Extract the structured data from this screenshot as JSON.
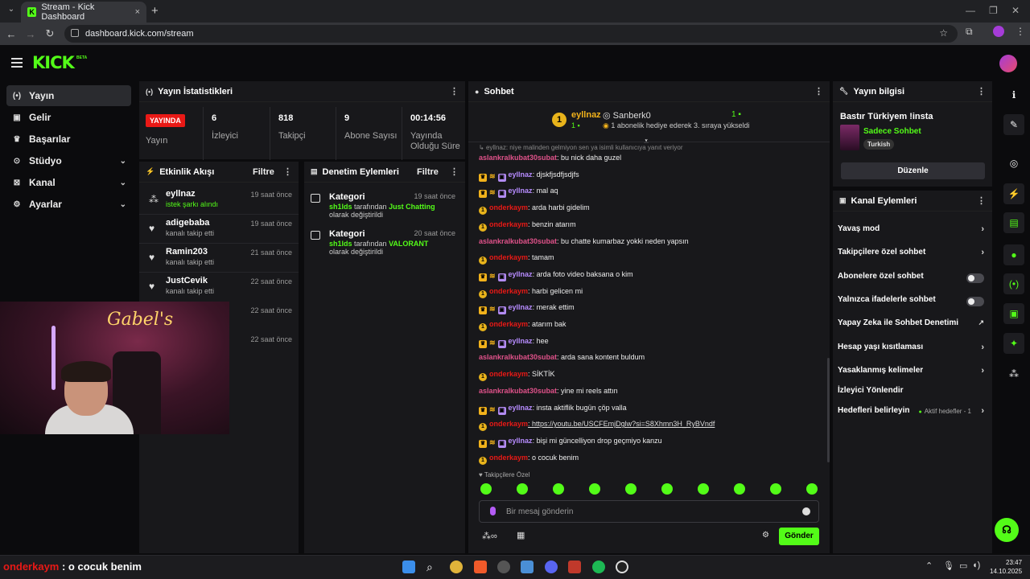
{
  "browser": {
    "tab_title": "Stream - Kick Dashboard",
    "url": "dashboard.kick.com/stream",
    "new_tab": "+",
    "close_tab": "×"
  },
  "app": {
    "logo": "KICK",
    "beta": "BETA"
  },
  "sidebar": {
    "items": [
      {
        "label": "Yayın",
        "icon": "broadcast-icon"
      },
      {
        "label": "Gelir",
        "icon": "revenue-icon"
      },
      {
        "label": "Başarılar",
        "icon": "trophy-icon"
      },
      {
        "label": "Stüdyo",
        "icon": "studio-icon"
      },
      {
        "label": "Kanal",
        "icon": "channel-icon"
      },
      {
        "label": "Ayarlar",
        "icon": "gear-icon"
      }
    ]
  },
  "stats": {
    "title": "Yayın İstatistikleri",
    "live_badge": "YAYINDA",
    "live_label": "Yayın",
    "items": [
      {
        "value": "6",
        "label": "İzleyici"
      },
      {
        "value": "818",
        "label": "Takipçi"
      },
      {
        "value": "9",
        "label": "Abone Sayısı"
      },
      {
        "value": "00:14:56",
        "label": "Yayında Olduğu Süre"
      }
    ]
  },
  "activity": {
    "title": "Etkinlik Akışı",
    "filter": "Filtre",
    "items": [
      {
        "name": "eyllnaz",
        "sub": "istek şarkı alındı",
        "time": "19 saat önce"
      },
      {
        "name": "adigebaba",
        "sub": "kanalı takip etti",
        "time": "19 saat önce"
      },
      {
        "name": "Ramin203",
        "sub": "kanalı takip etti",
        "time": "21 saat önce"
      },
      {
        "name": "JustCevik",
        "sub": "kanalı takip etti",
        "time": "22 saat önce"
      },
      {
        "name": "",
        "sub": "",
        "time": "22 saat önce"
      },
      {
        "name": "",
        "sub": "",
        "time": "22 saat önce"
      }
    ]
  },
  "moderation": {
    "title": "Denetim Eylemleri",
    "filter": "Filtre",
    "items": [
      {
        "title": "Kategori",
        "actor": "sh1lds",
        "mid": " tarafından ",
        "target": "Just Chatting",
        "end": " olarak değiştirildi",
        "time": "19 saat önce"
      },
      {
        "title": "Kategori",
        "actor": "sh1lds",
        "mid": " tarafından ",
        "target": "VALORANT",
        "end": " olarak değiştirildi",
        "time": "20 saat önce"
      }
    ]
  },
  "chat": {
    "title": "Sohbet",
    "pinned_rank": "1",
    "pinned_user": "eyllnaz",
    "pinned_count": "1",
    "gifter": "Sanberk0",
    "gifter_count": "1",
    "gift_text": "1 abonelik hediye ederek 3. sıraya yükseldi",
    "reply_hint": "eyllnaz: niye malinden gelmiyon sen ya isimli kullanıcıya yanıt veriyor",
    "messages": [
      {
        "user": "aslankralkubat30subat",
        "text": ": bu nick daha guzel",
        "style": "pink"
      },
      {
        "user": "eyllnaz",
        "text": ": djskfjsdfjsdjfs",
        "style": "purple"
      },
      {
        "user": "eyllnaz",
        "text": ": mal aq",
        "style": "purple"
      },
      {
        "user": "onderkaym",
        "text": ": arda harbi gidelim",
        "style": "red"
      },
      {
        "user": "onderkaym",
        "text": ": benzin atarım",
        "style": "red"
      },
      {
        "user": "aslankralkubat30subat",
        "text": ": bu chatte kumarbaz yokki neden yapsın",
        "style": "pink"
      },
      {
        "user": "onderkaym",
        "text": ": tamam",
        "style": "red"
      },
      {
        "user": "eyllnaz",
        "text": ": arda foto video baksana o kim",
        "style": "purple"
      },
      {
        "user": "onderkaym",
        "text": ": harbi gelicen mi",
        "style": "red"
      },
      {
        "user": "eyllnaz",
        "text": ": merak ettim",
        "style": "purple"
      },
      {
        "user": "onderkaym",
        "text": ": atarım bak",
        "style": "red"
      },
      {
        "user": "eyllnaz",
        "text": ": hee",
        "style": "purple"
      },
      {
        "user": "aslankralkubat30subat",
        "text": ": arda sana kontent buldum",
        "style": "pink"
      },
      {
        "user": "onderkaym",
        "text": ": SİKTİK",
        "style": "red"
      },
      {
        "user": "aslankralkubat30subat",
        "text": ": yine mi reels attın",
        "style": "pink"
      },
      {
        "user": "eyllnaz",
        "text": ": insta aktiflik bugün çöp valla",
        "style": "purple"
      },
      {
        "user": "onderkaym",
        "text": ": https://youtu.be/USCFEmjDglw?si=S8Xhmn3H_RyBVndf",
        "style": "red"
      },
      {
        "user": "eyllnaz",
        "text": ": bişi mi güncelliyon drop geçmiyo kanzu",
        "style": "purple"
      },
      {
        "user": "onderkaym",
        "text": ": o cocuk benim",
        "style": "red"
      }
    ],
    "followers_only": "Takipçilere Özel",
    "input_placeholder": "Bir mesaj gönderin",
    "send": "Gönder"
  },
  "stream_info": {
    "title": "Yayın bilgisi",
    "stream_title": "Bastır Türkiyem !insta",
    "category": "Sadece Sohbet",
    "tag": "Turkish",
    "edit": "Düzenle"
  },
  "channel_actions": {
    "title": "Kanal Eylemleri",
    "items": [
      {
        "label": "Yavaş mod",
        "control": "arrow"
      },
      {
        "label": "Takipçilere özel sohbet",
        "control": "arrow"
      },
      {
        "label": "Abonelere özel sohbet",
        "control": "toggle"
      },
      {
        "label": "Yalnızca ifadelerle sohbet",
        "control": "toggle"
      },
      {
        "label": "Yapay Zeka ile Sohbet Denetimi",
        "control": "external"
      },
      {
        "label": "Hesap yaşı kısıtlaması",
        "control": "arrow"
      },
      {
        "label": "Yasaklanmış kelimeler",
        "control": "arrow"
      },
      {
        "label": "İzleyici Yönlendir",
        "control": "none"
      },
      {
        "label": "Hedefleri belirleyin",
        "control": "arrow",
        "sub": "Aktif hedefler - 1"
      }
    ]
  },
  "overlay_ticker": {
    "user": "onderkaym",
    "text": " : o cocuk benim"
  },
  "clock": {
    "time": "23:47",
    "date": "14.10.2025"
  },
  "colors": {
    "accent": "#53fc18",
    "live": "#e91916"
  }
}
